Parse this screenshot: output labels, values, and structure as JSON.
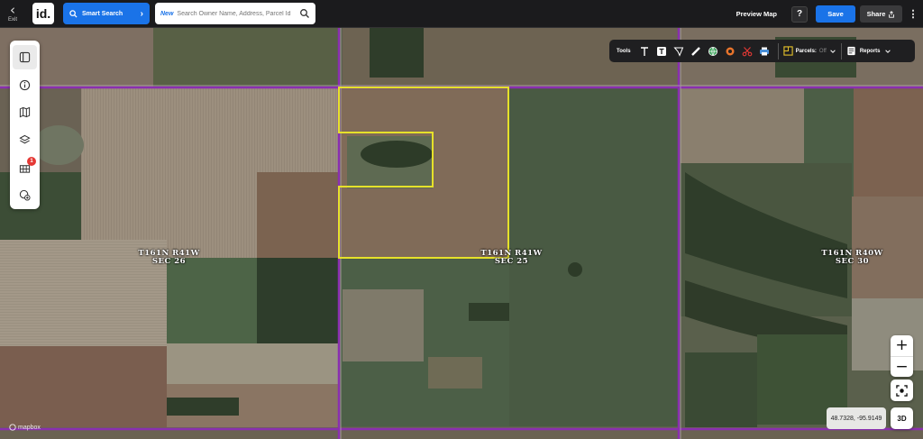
{
  "topbar": {
    "exit_label": "Exit",
    "logo_text": "id.",
    "smart_search_label": "Smart Search",
    "search_new_tag": "New",
    "search_placeholder": "Search Owner Name, Address, Parcel Id",
    "preview_map_label": "Preview Map",
    "help_label": "?",
    "save_label": "Save",
    "share_label": "Share",
    "menu_label": "⋮"
  },
  "sidebar": {
    "items": [
      {
        "name": "layers-panel",
        "icon": "panel-icon"
      },
      {
        "name": "info",
        "icon": "info-icon"
      },
      {
        "name": "basemap",
        "icon": "map-icon"
      },
      {
        "name": "layers",
        "icon": "layers-icon"
      },
      {
        "name": "data-layers",
        "icon": "grid-icon",
        "badge": "1"
      },
      {
        "name": "add-layer",
        "icon": "add-layer-icon"
      }
    ]
  },
  "toolsbar": {
    "tools_label": "Tools",
    "parcels_label": "Parcels:",
    "parcels_state": "Off",
    "reports_label": "Reports"
  },
  "map": {
    "section_labels": [
      {
        "line1": "T161N R41W",
        "line2": "SEC 26"
      },
      {
        "line1": "T161N R41W",
        "line2": "SEC 25"
      },
      {
        "line1": "T161N R40W",
        "line2": "SEC 30"
      }
    ],
    "coordinates": "48.7328, -95.9149",
    "zoom_in": "+",
    "zoom_out": "−",
    "btn_3d": "3D",
    "attribution": "mapbox",
    "colors": {
      "parcel_outline": "#e6e12a",
      "section_line": "#8a2fb0"
    }
  }
}
